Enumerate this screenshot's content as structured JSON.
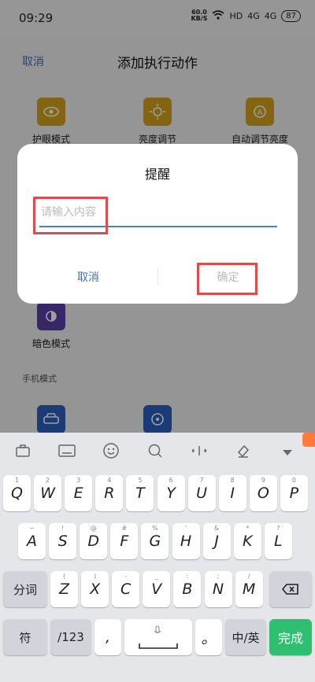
{
  "status": {
    "time": "09:29",
    "net_speed_value": "60.0",
    "net_speed_unit": "KB/S",
    "hd": "HD",
    "signal1": "4G",
    "signal2": "4G",
    "battery": "87"
  },
  "app": {
    "cancel_label": "取消",
    "title": "添加执行动作",
    "tiles": [
      {
        "label": "护眼模式",
        "icon": "eye-icon"
      },
      {
        "label": "亮度调节",
        "icon": "brightness-icon"
      },
      {
        "label": "自动调节亮度",
        "icon": "auto-brightness-icon"
      },
      {
        "label": "暗色模式",
        "icon": "dark-mode-icon"
      }
    ],
    "section_label": "手机模式",
    "colors": {
      "yellow": "#d4a21c",
      "purple": "#5b3fa8",
      "blue": "#2c5fbf"
    }
  },
  "dialog": {
    "title": "提醒",
    "input_placeholder": "请输入内容",
    "input_value": "",
    "cancel_label": "取消",
    "ok_label": "确定",
    "highlight_color": "#e04b4b"
  },
  "keyboard": {
    "toolbar_icons": [
      "briefcase-icon",
      "keyboard-icon",
      "emoji-icon",
      "search-icon",
      "cursor-icon",
      "clear-format-icon",
      "collapse-icon"
    ],
    "row1": [
      {
        "k": "Q",
        "s": "1"
      },
      {
        "k": "W",
        "s": "2"
      },
      {
        "k": "E",
        "s": "3"
      },
      {
        "k": "R",
        "s": "4"
      },
      {
        "k": "T",
        "s": "5"
      },
      {
        "k": "Y",
        "s": "6"
      },
      {
        "k": "U",
        "s": "7"
      },
      {
        "k": "I",
        "s": "8"
      },
      {
        "k": "O",
        "s": "9"
      },
      {
        "k": "P",
        "s": "0"
      }
    ],
    "row2": [
      {
        "k": "A",
        "s": "~"
      },
      {
        "k": "S",
        "s": "!"
      },
      {
        "k": "D",
        "s": "@"
      },
      {
        "k": "F",
        "s": "#"
      },
      {
        "k": "G",
        "s": "%"
      },
      {
        "k": "H",
        "s": "'"
      },
      {
        "k": "J",
        "s": "&"
      },
      {
        "k": "K",
        "s": "*"
      },
      {
        "k": "L",
        "s": "?"
      }
    ],
    "row3": [
      {
        "k": "Z",
        "s": "("
      },
      {
        "k": "X",
        "s": ")"
      },
      {
        "k": "C",
        "s": "-"
      },
      {
        "k": "V",
        "s": "_"
      },
      {
        "k": "B",
        "s": ":"
      },
      {
        "k": "N",
        "s": ";"
      },
      {
        "k": "M",
        "s": "/"
      }
    ],
    "split_label": "分词",
    "symbol_label": "符",
    "num_label": "/123",
    "comma": ",",
    "period": "。",
    "lang_label": "中/英",
    "done_label": "完成"
  }
}
